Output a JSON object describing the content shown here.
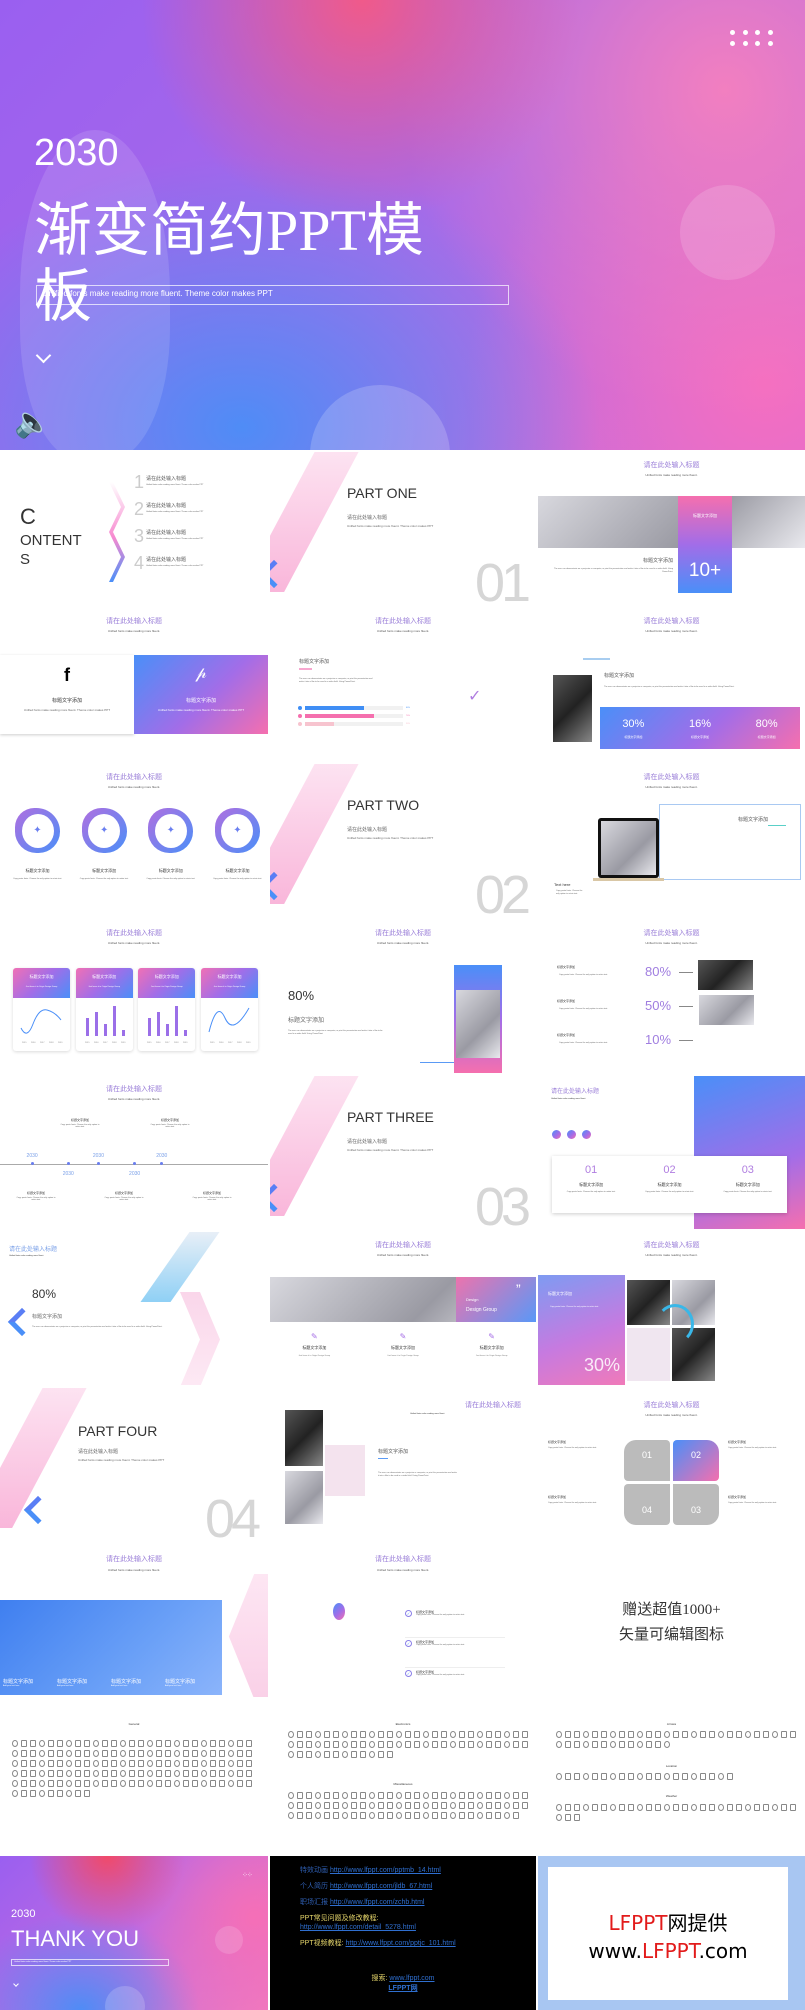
{
  "colors": {
    "gradient_start": "#4a8ff8",
    "gradient_mid": "#a26de8",
    "gradient_end": "#f56fae",
    "title_purple": "#9a7ed8"
  },
  "common": {
    "placeholder_title": "请在此处输入标题",
    "placeholder_sub": "Unified fonts make reading more fluent.",
    "heading": "标题文字添加",
    "unified": "Unified fonts make reading more fluent. Theme color makes PPT",
    "copy_paste": "Copy paste fonts. Choose the only option to retain text.",
    "body": "The user can demonstrate on a projector or computer, or print the presentation and make it into a film to be used in a wider field. Using PowerPoint.",
    "origin": "Just leave it to Origin Design Group"
  },
  "hero": {
    "year": "2030",
    "title": "渐变简约PPT模板",
    "subtitle": "Unified fonts make reading more fluent. Theme color makes PPT",
    "menu_icon": "dots-grid-icon",
    "audio_icon": "speaker-icon"
  },
  "contents": {
    "c": "C",
    "ontent": "ONTENT",
    "s": "S",
    "items": [
      {
        "n": "1",
        "t": "请在此处输入标题"
      },
      {
        "n": "2",
        "t": "请在此处输入标题"
      },
      {
        "n": "3",
        "t": "请在此处输入标题"
      },
      {
        "n": "4",
        "t": "请在此处输入标题"
      }
    ]
  },
  "parts": [
    {
      "title": "PART ONE",
      "num": "01"
    },
    {
      "title": "PART TWO",
      "num": "02"
    },
    {
      "title": "PART THREE",
      "num": "03"
    },
    {
      "title": "PART FOUR",
      "num": "04"
    }
  ],
  "ten_plus": "10+",
  "progress": [
    {
      "label": "60%",
      "value": 60,
      "color": "#3f8ef5"
    },
    {
      "label": "70%",
      "value": 70,
      "color": "#f56fae"
    },
    {
      "label": "30%",
      "value": 30,
      "color": "#f7c4cf"
    }
  ],
  "stats": [
    {
      "value": "30%",
      "label": "标题文字添加"
    },
    {
      "value": "16%",
      "label": "标题文字添加"
    },
    {
      "value": "80%",
      "label": "标题文字添加"
    }
  ],
  "text_here": "Text here",
  "mini_charts": {
    "axis": [
      "2015",
      "2016",
      "2017",
      "2018",
      "2019"
    ],
    "bars": [
      3,
      4,
      2,
      5,
      1
    ]
  },
  "eighty": "80%",
  "percent_rows": [
    {
      "value": "80%"
    },
    {
      "value": "50%"
    },
    {
      "value": "10%"
    }
  ],
  "timeline": [
    "2030",
    "2030",
    "2030",
    "2030",
    "2030"
  ],
  "steps": [
    "01",
    "02",
    "03"
  ],
  "design": {
    "line1": "Design",
    "line2": "Design Group"
  },
  "thirty": "30%",
  "quad": [
    "01",
    "02",
    "03",
    "04"
  ],
  "add_text": "Add your text here",
  "gift": {
    "line1": "赠送超值1000+",
    "line2": "矢量可编辑图标"
  },
  "icon_sets": {
    "general": "General",
    "electronics": "Electronics",
    "misc": "Miscellaneous",
    "arrows": "Arrows",
    "location": "Location",
    "weather": "Weather"
  },
  "thanks": {
    "year": "2030",
    "title": "THANK YOU",
    "subtitle": "Unified fonts make reading more fluent. Theme color makes PPT"
  },
  "links": [
    {
      "label": "特效动画",
      "url": "http://www.lfppt.com/pptmb_14.html"
    },
    {
      "label": "个人简历",
      "url": "http://www.lfppt.com/jldb_67.html"
    },
    {
      "label": "职场汇报",
      "url": "http://www.lfppt.com/zchb.html"
    },
    {
      "label": "PPT常见问题及修改教程:",
      "url": "http://www.lfppt.com/detail_5278.html"
    },
    {
      "label": "PPT视频教程:",
      "url": "http://www.lfppt.com/pptjc_101.html"
    }
  ],
  "search": {
    "label": "搜索:",
    "url": "www.lfppt.com",
    "brand": "LFPPT网"
  },
  "brand": {
    "red1": "LFPPT",
    "black1": "网提供",
    "pre": "www.",
    "red2": "LFPPT",
    "post": ".com"
  }
}
